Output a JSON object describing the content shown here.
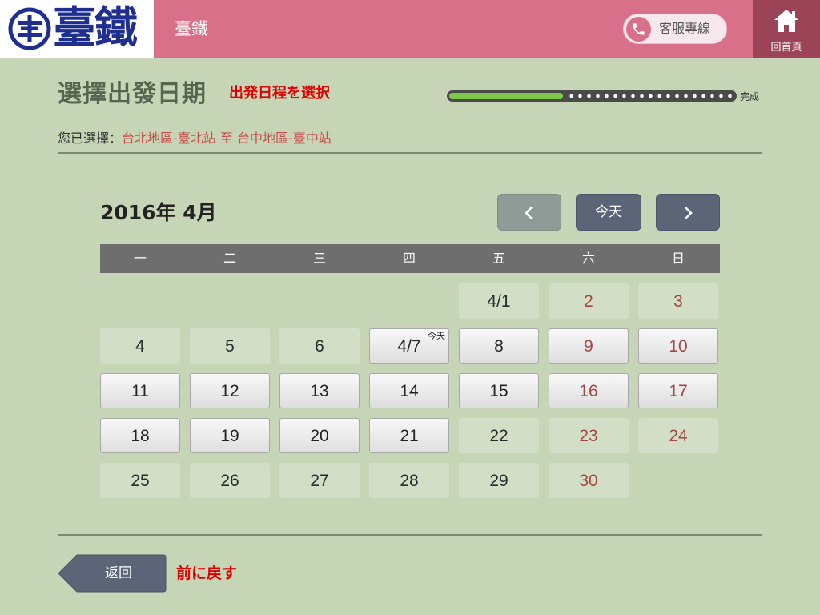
{
  "header": {
    "logo_text": "臺鐵",
    "title": "臺鐵",
    "hotline_label": "客服專線",
    "home_label": "回首頁"
  },
  "page": {
    "title": "選擇出發日期",
    "title_jp": "出発日程を選択",
    "progress_fraction": 0.4,
    "progress_done_label": "完成",
    "selected_prefix": "您已選擇：",
    "selected_route": "台北地區-臺北站 至 台中地區-臺中站"
  },
  "calendar": {
    "month_label": "2016年 4月",
    "prev_icon": "chevron-left-icon",
    "today_button": "今天",
    "next_icon": "chevron-right-icon",
    "weekdays": [
      "一",
      "二",
      "三",
      "四",
      "五",
      "六",
      "日"
    ],
    "today_badge": "今天",
    "rows": [
      [
        "",
        "",
        "",
        "",
        "4/1",
        "2",
        "3"
      ],
      [
        "4",
        "5",
        "6",
        "4/7",
        "8",
        "9",
        "10"
      ],
      [
        "11",
        "12",
        "13",
        "14",
        "15",
        "16",
        "17"
      ],
      [
        "18",
        "19",
        "20",
        "21",
        "22",
        "23",
        "24"
      ],
      [
        "25",
        "26",
        "27",
        "28",
        "29",
        "30",
        ""
      ]
    ]
  },
  "footer": {
    "back_label": "返回",
    "back_jp": "前に戻す"
  },
  "colors": {
    "background": "#c5d5b5",
    "header": "#d9708a",
    "home_button": "#9c4457",
    "weekend_text": "#a64545",
    "annotation_red": "#e00000"
  }
}
